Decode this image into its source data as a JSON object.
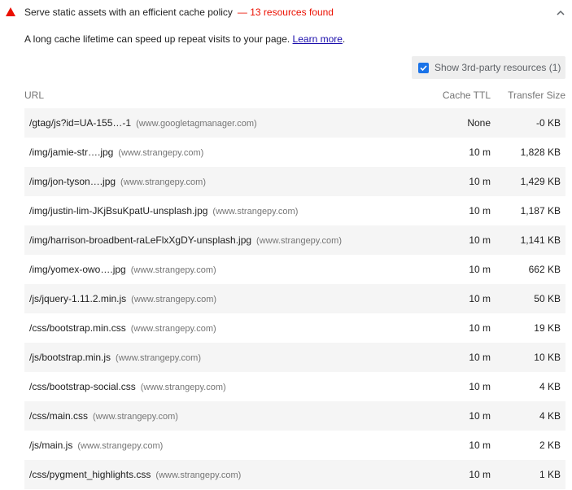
{
  "audit": {
    "title": "Serve static assets with an efficient cache policy",
    "display_value": "— 13 resources found",
    "description": "A long cache lifetime can speed up repeat visits to your page.",
    "learn_more": "Learn more",
    "description_end": "."
  },
  "third_party": {
    "label": "Show 3rd-party resources (1)",
    "checked": true
  },
  "table": {
    "headers": {
      "url": "URL",
      "cache_ttl": "Cache TTL",
      "transfer_size": "Transfer Size"
    },
    "rows": [
      {
        "url": "/gtag/js?id=UA-155…-1",
        "host": "(www.googletagmanager.com)",
        "ttl": "None",
        "size": "-0 KB"
      },
      {
        "url": "/img/jamie-str….jpg",
        "host": "(www.strangepy.com)",
        "ttl": "10 m",
        "size": "1,828 KB"
      },
      {
        "url": "/img/jon-tyson….jpg",
        "host": "(www.strangepy.com)",
        "ttl": "10 m",
        "size": "1,429 KB"
      },
      {
        "url": "/img/justin-lim-JKjBsuKpatU-unsplash.jpg",
        "host": "(www.strangepy.com)",
        "ttl": "10 m",
        "size": "1,187 KB"
      },
      {
        "url": "/img/harrison-broadbent-raLeFlxXgDY-unsplash.jpg",
        "host": "(www.strangepy.com)",
        "ttl": "10 m",
        "size": "1,141 KB"
      },
      {
        "url": "/img/yomex-owo….jpg",
        "host": "(www.strangepy.com)",
        "ttl": "10 m",
        "size": "662 KB"
      },
      {
        "url": "/js/jquery-1.11.2.min.js",
        "host": "(www.strangepy.com)",
        "ttl": "10 m",
        "size": "50 KB"
      },
      {
        "url": "/css/bootstrap.min.css",
        "host": "(www.strangepy.com)",
        "ttl": "10 m",
        "size": "19 KB"
      },
      {
        "url": "/js/bootstrap.min.js",
        "host": "(www.strangepy.com)",
        "ttl": "10 m",
        "size": "10 KB"
      },
      {
        "url": "/css/bootstrap-social.css",
        "host": "(www.strangepy.com)",
        "ttl": "10 m",
        "size": "4 KB"
      },
      {
        "url": "/css/main.css",
        "host": "(www.strangepy.com)",
        "ttl": "10 m",
        "size": "4 KB"
      },
      {
        "url": "/js/main.js",
        "host": "(www.strangepy.com)",
        "ttl": "10 m",
        "size": "2 KB"
      },
      {
        "url": "/css/pygment_highlights.css",
        "host": "(www.strangepy.com)",
        "ttl": "10 m",
        "size": "1 KB"
      }
    ]
  },
  "icons": {
    "warning": "warning-triangle-icon",
    "collapse": "chevron-up-icon",
    "checkbox": "checkmark-icon"
  },
  "colors": {
    "fail": "#eb0f00",
    "link": "#1a0dab",
    "checkbox": "#1a73e8",
    "row_stripe": "#f5f5f5"
  }
}
